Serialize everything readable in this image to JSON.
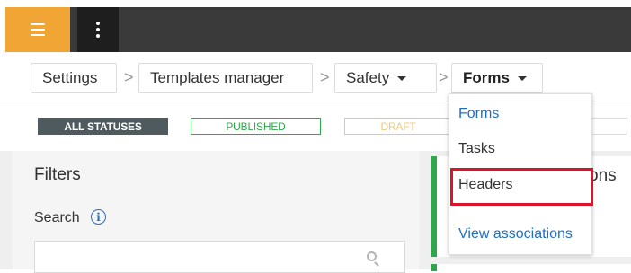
{
  "topbar": {
    "menu_icon": "hamburger-icon",
    "more_icon": "kebab-icon"
  },
  "breadcrumb": {
    "items": [
      {
        "label": "Settings"
      },
      {
        "label": "Templates manager"
      },
      {
        "label": "Safety"
      },
      {
        "label": "Forms"
      }
    ],
    "separator": ">"
  },
  "statuses": {
    "all": "ALL STATUSES",
    "published": "PUBLISHED",
    "draft": "DRAFT"
  },
  "filters": {
    "title": "Filters",
    "search_label": "Search",
    "info_glyph": "i",
    "search_value": ""
  },
  "card": {
    "title_fragment": "ons"
  },
  "dropdown": {
    "items": [
      {
        "label": "Forms"
      },
      {
        "label": "Tasks"
      },
      {
        "label": "Headers"
      },
      {
        "label": "View associations"
      }
    ]
  },
  "colors": {
    "accent_orange": "#f1a534",
    "topbar": "#3a3a3a",
    "link_blue": "#1f6fc5",
    "published_green": "#2ea84a",
    "draft_yellow": "#f1c877",
    "highlight_red": "#d9142b"
  }
}
